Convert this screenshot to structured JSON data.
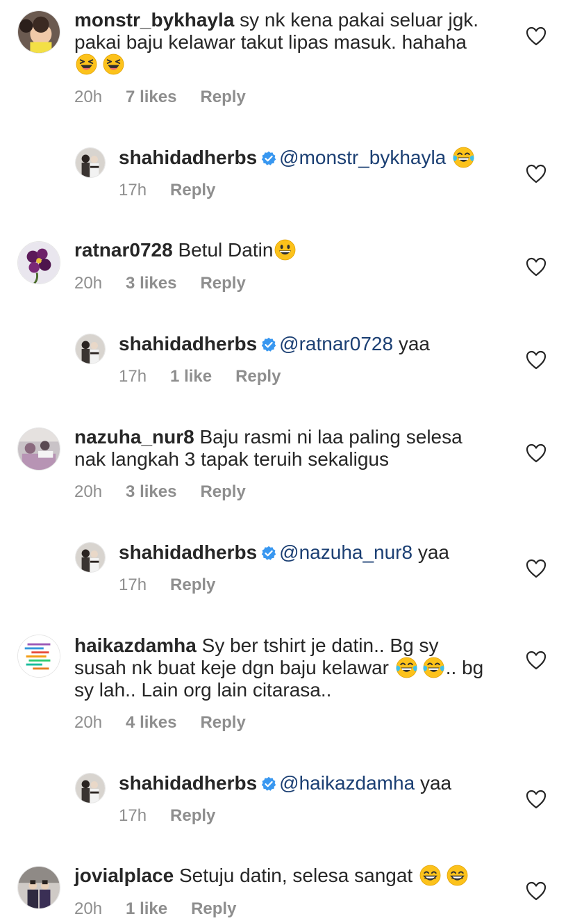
{
  "comments": [
    {
      "username": "monstr_bykhayla",
      "text": "sy nk kena pakai seluar jgk.",
      "text_line2": "pakai baju kelawar takut lipas masuk. hahaha",
      "emojis": [
        "laughing",
        "laughing"
      ],
      "time": "20h",
      "likes": "7 likes",
      "reply": "Reply"
    },
    {
      "username": "shahidadherbs",
      "verified": true,
      "mention": "@monstr_bykhayla",
      "emojis": [
        "joy"
      ],
      "time": "17h",
      "reply": "Reply"
    },
    {
      "username": "ratnar0728",
      "text": "Betul Datin",
      "emojis": [
        "smiley"
      ],
      "time": "20h",
      "likes": "3 likes",
      "reply": "Reply"
    },
    {
      "username": "shahidadherbs",
      "verified": true,
      "mention": "@ratnar0728",
      "text": "yaa",
      "time": "17h",
      "likes": "1 like",
      "reply": "Reply"
    },
    {
      "username": "nazuha_nur8",
      "text": "Baju rasmi ni laa paling selesa",
      "text_line2": "nak langkah 3 tapak teruih sekaligus",
      "time": "20h",
      "likes": "3 likes",
      "reply": "Reply"
    },
    {
      "username": "shahidadherbs",
      "verified": true,
      "mention": "@nazuha_nur8",
      "text": "yaa",
      "time": "17h",
      "reply": "Reply"
    },
    {
      "username": "haikazdamha",
      "text": "Sy ber tshirt je datin.. Bg sy",
      "text_line2a": "susah nk buat keje dgn baju kelawar",
      "emojis": [
        "joy",
        "joy"
      ],
      "text_line2b": ".. bg",
      "text_line3": "sy lah.. Lain org lain citarasa..",
      "time": "20h",
      "likes": "4 likes",
      "reply": "Reply"
    },
    {
      "username": "shahidadherbs",
      "verified": true,
      "mention": "@haikazdamha",
      "text": "yaa",
      "time": "17h",
      "reply": "Reply"
    },
    {
      "username": "jovialplace",
      "text": "Setuju datin, selesa sangat",
      "emojis": [
        "grin",
        "grin"
      ],
      "time": "20h",
      "likes": "1 like",
      "reply": "Reply"
    }
  ],
  "icons": {
    "heart": "heart-outline-icon",
    "verified": "verified-badge-icon"
  },
  "colors": {
    "text": "#262626",
    "meta": "#8e8e8e",
    "mention": "#1b3f73",
    "verified": "#3897f0"
  }
}
